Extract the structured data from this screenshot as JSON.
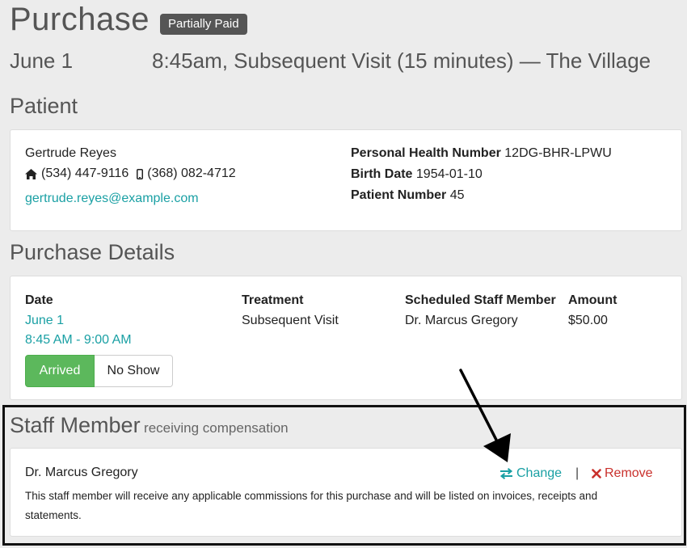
{
  "header": {
    "title": "Purchase",
    "status_badge": "Partially Paid",
    "date": "June 1",
    "details": "8:45am, Subsequent Visit (15 minutes)  — The Village"
  },
  "patient": {
    "section_title": "Patient",
    "name": "Gertrude Reyes",
    "home_phone": "(534) 447-9116",
    "mobile_phone": "(368) 082-4712",
    "email": "gertrude.reyes@example.com",
    "phn_label": "Personal Health Number",
    "phn_value": "12DG-BHR-LPWU",
    "birth_label": "Birth Date",
    "birth_value": "1954-01-10",
    "patient_number_label": "Patient Number",
    "patient_number_value": "45"
  },
  "purchase_details": {
    "section_title": "Purchase Details",
    "date_header": "Date",
    "date_value": "June 1",
    "time_value": "8:45 AM - 9:00 AM",
    "treatment_header": "Treatment",
    "treatment_value": "Subsequent Visit",
    "staff_header": "Scheduled Staff Member",
    "staff_value": "Dr. Marcus Gregory",
    "amount_header": "Amount",
    "amount_value": "$50.00",
    "arrived_label": "Arrived",
    "noshow_label": "No Show"
  },
  "staff_member": {
    "section_title": "Staff Member",
    "section_subtitle": "receiving compensation",
    "name": "Dr. Marcus Gregory",
    "change_label": "Change",
    "separator": "|",
    "remove_label": "Remove",
    "description": "This staff member will receive any applicable commissions for this purchase and will be listed on invoices, receipts and statements."
  },
  "colors": {
    "accent": "#1aa0a4",
    "arrived": "#5cb85c",
    "remove": "#c9302c",
    "badge": "#555555"
  },
  "icons": {
    "home": "home-icon",
    "mobile": "mobile-icon",
    "change": "exchange-icon",
    "remove": "times-icon",
    "annotation": "arrow-annotation"
  }
}
